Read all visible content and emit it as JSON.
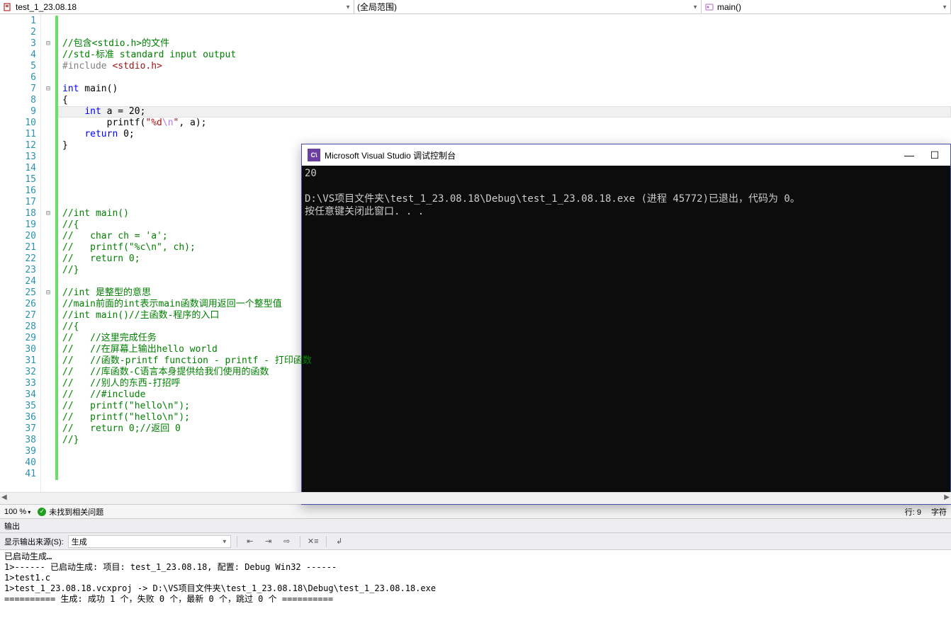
{
  "nav": {
    "file": "test_1_23.08.18",
    "scope": "(全局范围)",
    "func": "main()"
  },
  "editor": {
    "line_count": 41,
    "highlight_line": 9,
    "lines": [
      {
        "n": 1,
        "fold": "",
        "html": ""
      },
      {
        "n": 2,
        "fold": "",
        "html": ""
      },
      {
        "n": 3,
        "fold": "⊟",
        "html": "<span class='c-comment'>//包含&lt;stdio.h&gt;的文件</span>"
      },
      {
        "n": 4,
        "fold": "",
        "html": "<span class='c-comment'>//std-标准 standard input output</span>"
      },
      {
        "n": 5,
        "fold": "",
        "html": "<span class='c-include'>#include </span><span class='c-angle'>&lt;stdio.h&gt;</span>"
      },
      {
        "n": 6,
        "fold": "",
        "html": ""
      },
      {
        "n": 7,
        "fold": "⊟",
        "html": "<span class='c-type'>int</span> main()"
      },
      {
        "n": 8,
        "fold": "",
        "html": "{"
      },
      {
        "n": 9,
        "fold": "",
        "html": "    <span class='c-type'>int</span> a = 20;"
      },
      {
        "n": 10,
        "fold": "",
        "html": "        printf(<span class='c-string'>\"%d</span><span class='c-escape'>\\n</span><span class='c-string'>\"</span>, a);"
      },
      {
        "n": 11,
        "fold": "",
        "html": "    <span class='c-keyword'>return</span> 0;"
      },
      {
        "n": 12,
        "fold": "",
        "html": "}"
      },
      {
        "n": 13,
        "fold": "",
        "html": ""
      },
      {
        "n": 14,
        "fold": "",
        "html": ""
      },
      {
        "n": 15,
        "fold": "",
        "html": ""
      },
      {
        "n": 16,
        "fold": "",
        "html": ""
      },
      {
        "n": 17,
        "fold": "",
        "html": ""
      },
      {
        "n": 18,
        "fold": "⊟",
        "html": "<span class='c-comment'>//int main()</span>"
      },
      {
        "n": 19,
        "fold": "",
        "html": "<span class='c-comment'>//{</span>"
      },
      {
        "n": 20,
        "fold": "",
        "html": "<span class='c-comment'>//   char ch = 'a';</span>"
      },
      {
        "n": 21,
        "fold": "",
        "html": "<span class='c-comment'>//   printf(\"%c\\n\", ch);</span>"
      },
      {
        "n": 22,
        "fold": "",
        "html": "<span class='c-comment'>//   return 0;</span>"
      },
      {
        "n": 23,
        "fold": "",
        "html": "<span class='c-comment'>//}</span>"
      },
      {
        "n": 24,
        "fold": "",
        "html": ""
      },
      {
        "n": 25,
        "fold": "⊟",
        "html": "<span class='c-comment'>//int 是整型的意思</span>"
      },
      {
        "n": 26,
        "fold": "",
        "html": "<span class='c-comment'>//main前面的int表示main函数调用返回一个整型值</span>"
      },
      {
        "n": 27,
        "fold": "",
        "html": "<span class='c-comment'>//int main()//主函数-程序的入口</span>"
      },
      {
        "n": 28,
        "fold": "",
        "html": "<span class='c-comment'>//{</span>"
      },
      {
        "n": 29,
        "fold": "",
        "html": "<span class='c-comment'>//   //这里完成任务</span>"
      },
      {
        "n": 30,
        "fold": "",
        "html": "<span class='c-comment'>//   //在屏幕上输出hello world</span>"
      },
      {
        "n": 31,
        "fold": "",
        "html": "<span class='c-comment'>//   //函数-printf function - printf - 打印函数</span>"
      },
      {
        "n": 32,
        "fold": "",
        "html": "<span class='c-comment'>//   //库函数-C语言本身提供给我们使用的函数</span>"
      },
      {
        "n": 33,
        "fold": "",
        "html": "<span class='c-comment'>//   //别人的东西-打招呼</span>"
      },
      {
        "n": 34,
        "fold": "",
        "html": "<span class='c-comment'>//   //#include</span>"
      },
      {
        "n": 35,
        "fold": "",
        "html": "<span class='c-comment'>//   printf(\"hello\\n\");</span>"
      },
      {
        "n": 36,
        "fold": "",
        "html": "<span class='c-comment'>//   printf(\"hello\\n\");</span>"
      },
      {
        "n": 37,
        "fold": "",
        "html": "<span class='c-comment'>//   return 0;//返回 0</span>"
      },
      {
        "n": 38,
        "fold": "",
        "html": "<span class='c-comment'>//}</span>"
      },
      {
        "n": 39,
        "fold": "",
        "html": ""
      },
      {
        "n": 40,
        "fold": "",
        "html": ""
      },
      {
        "n": 41,
        "fold": "",
        "html": ""
      }
    ]
  },
  "console": {
    "title": "Microsoft Visual Studio 调试控制台",
    "lines": [
      "20",
      "",
      "D:\\VS项目文件夹\\test_1_23.08.18\\Debug\\test_1_23.08.18.exe (进程 45772)已退出，代码为 0。",
      "按任意键关闭此窗口. . ."
    ]
  },
  "status": {
    "zoom": "100 %",
    "issues": "未找到相关问题",
    "line": "行: 9",
    "char": "字符"
  },
  "output": {
    "header": "输出",
    "source_label": "显示输出来源(S):",
    "source_value": "生成",
    "body": "已启动生成…\n1>------ 已启动生成: 项目: test_1_23.08.18, 配置: Debug Win32 ------\n1>test1.c\n1>test_1_23.08.18.vcxproj -> D:\\VS项目文件夹\\test_1_23.08.18\\Debug\\test_1_23.08.18.exe\n========== 生成: 成功 1 个，失败 0 个，最新 0 个，跳过 0 个 =========="
  }
}
